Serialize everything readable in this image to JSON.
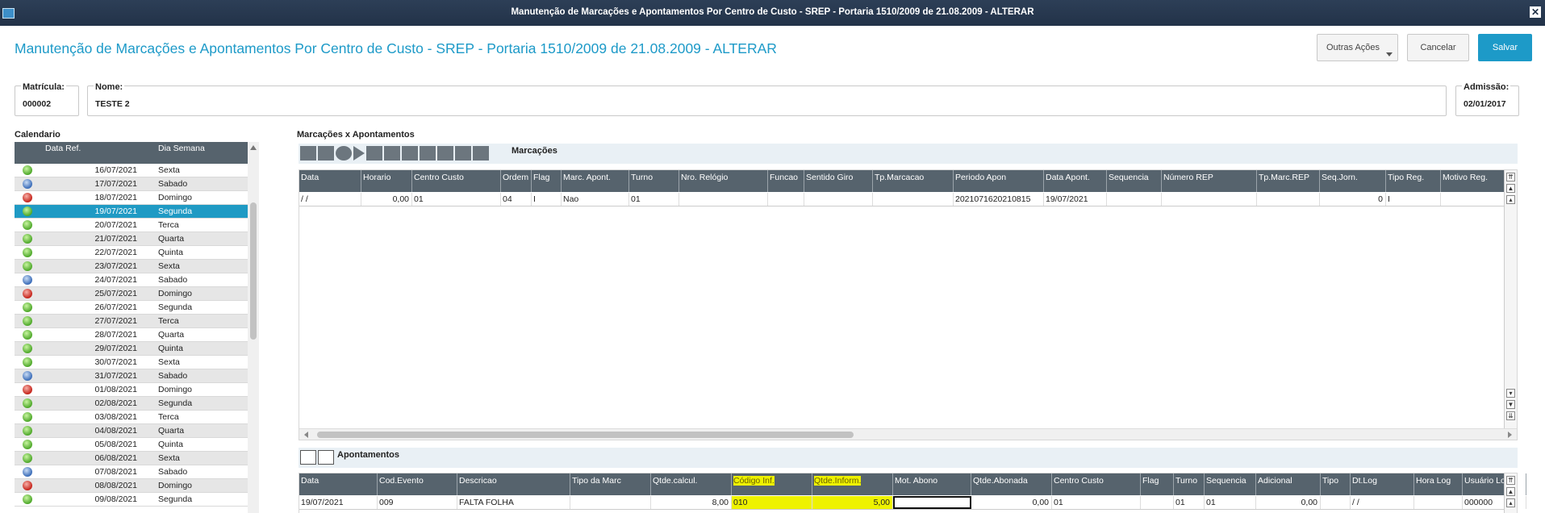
{
  "window": {
    "title": "Manutenção de Marcações e Apontamentos Por Centro de Custo - SREP - Portaria 1510/2009 de 21.08.2009 - ALTERAR"
  },
  "header": {
    "title": "Manutenção de Marcações e Apontamentos Por Centro de Custo - SREP - Portaria 1510/2009 de 21.08.2009 - ALTERAR",
    "outras_label": "Outras Ações",
    "cancel_label": "Cancelar",
    "save_label": "Salvar",
    "accent": "#1d9ac8"
  },
  "fields": {
    "matricula": {
      "label": "Matrícula:",
      "value": "000002"
    },
    "nome": {
      "label": "Nome:",
      "value": "TESTE 2"
    },
    "admissao": {
      "label": "Admissão:",
      "value": "02/01/2017"
    }
  },
  "calendario": {
    "title": "Calendario",
    "headers": [
      "Data Ref.",
      "Dia Semana"
    ],
    "rows": [
      {
        "status": "green",
        "date": "16/07/2021",
        "day": "Sexta"
      },
      {
        "status": "blue",
        "date": "17/07/2021",
        "day": "Sabado"
      },
      {
        "status": "red",
        "date": "18/07/2021",
        "day": "Domingo"
      },
      {
        "status": "green",
        "date": "19/07/2021",
        "day": "Segunda",
        "selected": true
      },
      {
        "status": "green",
        "date": "20/07/2021",
        "day": "Terca"
      },
      {
        "status": "green",
        "date": "21/07/2021",
        "day": "Quarta"
      },
      {
        "status": "green",
        "date": "22/07/2021",
        "day": "Quinta"
      },
      {
        "status": "green",
        "date": "23/07/2021",
        "day": "Sexta"
      },
      {
        "status": "blue",
        "date": "24/07/2021",
        "day": "Sabado"
      },
      {
        "status": "red",
        "date": "25/07/2021",
        "day": "Domingo"
      },
      {
        "status": "green",
        "date": "26/07/2021",
        "day": "Segunda"
      },
      {
        "status": "green",
        "date": "27/07/2021",
        "day": "Terca"
      },
      {
        "status": "green",
        "date": "28/07/2021",
        "day": "Quarta"
      },
      {
        "status": "green",
        "date": "29/07/2021",
        "day": "Quinta"
      },
      {
        "status": "green",
        "date": "30/07/2021",
        "day": "Sexta"
      },
      {
        "status": "blue",
        "date": "31/07/2021",
        "day": "Sabado"
      },
      {
        "status": "red",
        "date": "01/08/2021",
        "day": "Domingo"
      },
      {
        "status": "green",
        "date": "02/08/2021",
        "day": "Segunda"
      },
      {
        "status": "green",
        "date": "03/08/2021",
        "day": "Terca"
      },
      {
        "status": "green",
        "date": "04/08/2021",
        "day": "Quarta"
      },
      {
        "status": "green",
        "date": "05/08/2021",
        "day": "Quinta"
      },
      {
        "status": "green",
        "date": "06/08/2021",
        "day": "Sexta"
      },
      {
        "status": "blue",
        "date": "07/08/2021",
        "day": "Sabado"
      },
      {
        "status": "red",
        "date": "08/08/2021",
        "day": "Domingo"
      },
      {
        "status": "green",
        "date": "09/08/2021",
        "day": "Segunda"
      }
    ]
  },
  "section_title": "Marcações x Apontamentos",
  "marcacoes": {
    "title": "Marcações",
    "columns": [
      "Data",
      "Horario",
      "Centro Custo",
      "Ordem",
      "Flag",
      "Marc. Apont.",
      "Turno",
      "Nro. Relógio",
      "Funcao",
      "Sentido Giro",
      "Tp.Marcacao",
      "Periodo Apon",
      "Data Apont.",
      "Sequencia",
      "Número REP",
      "Tp.Marc.REP",
      "Seq.Jorn.",
      "Tipo Reg.",
      "Motivo Reg."
    ],
    "row": [
      "  /  /",
      "0,00",
      "01",
      "04",
      "I",
      "Nao",
      "01",
      "",
      "",
      "",
      "",
      "2021071620210815",
      "19/07/2021",
      "",
      "",
      "",
      "0",
      "I",
      ""
    ]
  },
  "apontamentos": {
    "title": "Apontamentos",
    "columns": [
      "Data",
      "Cod.Evento",
      "Descricao",
      "Tipo da Marc",
      "Qtde.calcul.",
      "Código Inf.",
      "Qtde.Inform.",
      "Mot. Abono",
      "Qtde.Abonada",
      "Centro Custo",
      "Flag",
      "Turno",
      "Sequencia",
      "Adicional",
      "Tipo",
      "Dt.Log",
      "Hora Log",
      "Usuário Log"
    ],
    "row": [
      "19/07/2021",
      "009",
      "FALTA FOLHA",
      "",
      "8,00",
      "010",
      "5,00",
      "",
      "0,00",
      "01",
      "",
      "01",
      "01",
      "0,00",
      "",
      "  /  /",
      "",
      "000000"
    ],
    "highlight_color": "#eef200"
  }
}
